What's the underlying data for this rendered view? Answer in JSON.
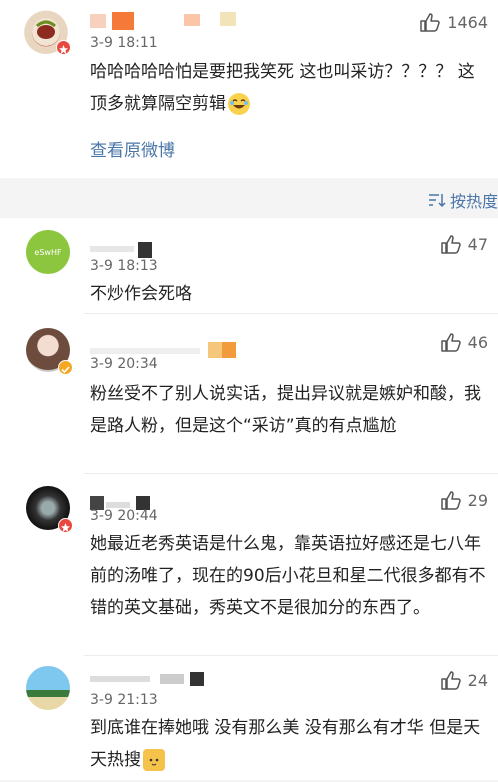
{
  "main_comment": {
    "time": "3-9 18:11",
    "likes": "1464",
    "text": "哈哈哈哈哈怕是要把我笑死 这也叫采访？？？？ 这顶多就算隔空剪辑",
    "view_original": "查看原微博"
  },
  "sort_label": "按热度",
  "replies": [
    {
      "time": "3-9 18:13",
      "likes": "47",
      "text": "不炒作会死咯",
      "avatar_text": "eSwHF"
    },
    {
      "time": "3-9 20:34",
      "likes": "46",
      "text": "粉丝受不了别人说实话，提出异议就是嫉妒和酸，我是路人粉，但是这个“采访”真的有点尴尬"
    },
    {
      "time": "3-9 20:44",
      "likes": "29",
      "text": "她最近老秀英语是什么鬼，靠英语拉好感还是七八年前的汤唯了，现在的90后小花旦和星二代很多都有不错的英文基础，秀英文不是很加分的东西了。"
    },
    {
      "time": "3-9 21:13",
      "likes": "24",
      "text": "到底谁在捧她哦 没有那么美 没有那么有才华 但是天天热搜"
    }
  ],
  "colors": {
    "link": "#4a76a8",
    "badge_red": "#e8483f",
    "badge_gold": "#f5a623"
  }
}
